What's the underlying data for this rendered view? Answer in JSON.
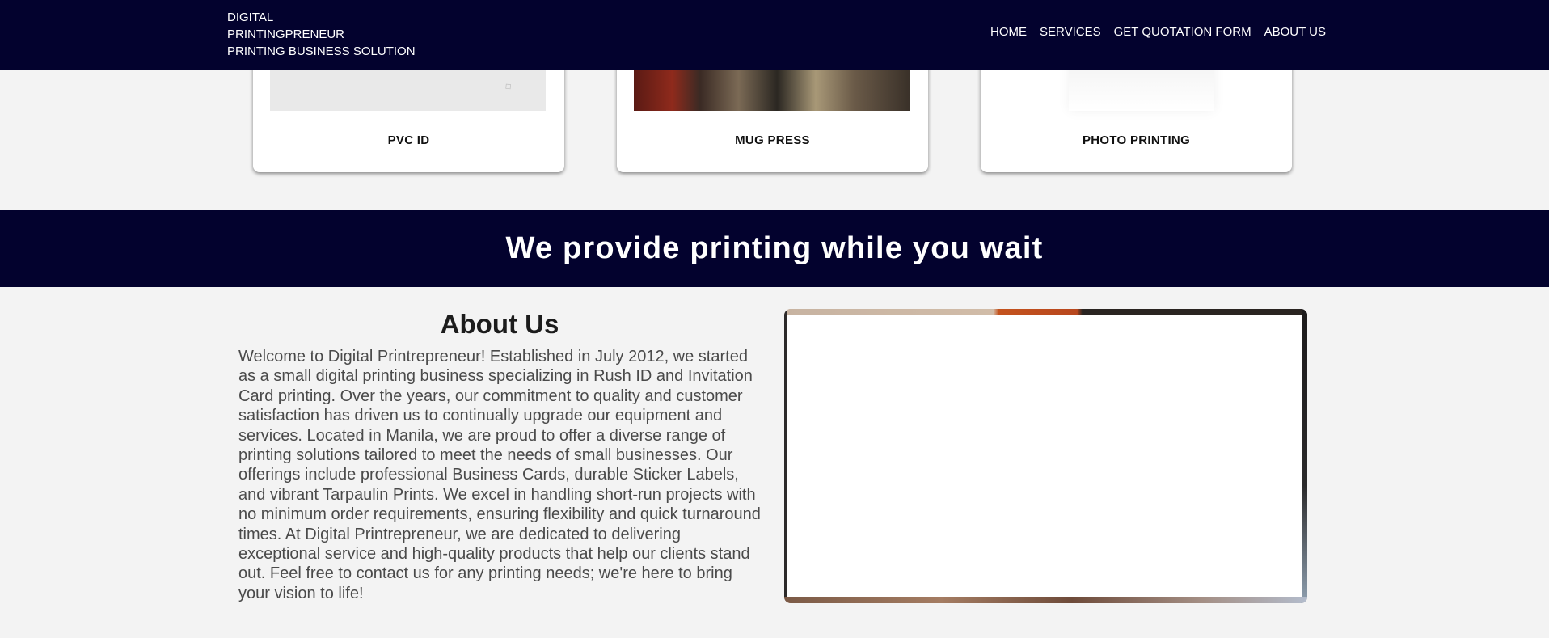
{
  "header": {
    "brand": {
      "line1": "DIGITAL",
      "line2": "PRINTINGPRENEUR",
      "line3": "PRINTING BUSINESS SOLUTION"
    },
    "nav": [
      {
        "label": "HOME"
      },
      {
        "label": "SERVICES"
      },
      {
        "label": "GET QUOTATION FORM"
      },
      {
        "label": "ABOUT US"
      }
    ],
    "colors": {
      "background": "#03022e",
      "text": "#ffffff"
    }
  },
  "services": [
    {
      "title": "PVC ID",
      "image": "pvc-id-card-image"
    },
    {
      "title": "MUG PRESS",
      "image": "mug-press-image"
    },
    {
      "title": "PHOTO PRINTING",
      "image": "photo-printing-image"
    }
  ],
  "banner": {
    "text": "We provide printing while you wait",
    "color": "#03022e"
  },
  "about": {
    "title": "About Us",
    "body": "Welcome to Digital Printrepreneur! Established in July 2012, we started as a small digital printing business specializing in Rush ID and Invitation Card printing. Over the years, our commitment to quality and customer satisfaction has driven us to continually upgrade our equipment and services. Located in Manila, we are proud to offer a diverse range of printing solutions tailored to meet the needs of small businesses. Our offerings include professional Business Cards, durable Sticker Labels, and vibrant Tarpaulin Prints. We excel in handling short-run projects with no minimum order requirements, ensuring flexibility and quick turnaround times. At Digital Printrepreneur, we are dedicated to delivering exceptional service and high-quality products that help our clients stand out. Feel free to contact us for any printing needs; we're here to bring your vision to life!",
    "media": "about-us-image"
  }
}
